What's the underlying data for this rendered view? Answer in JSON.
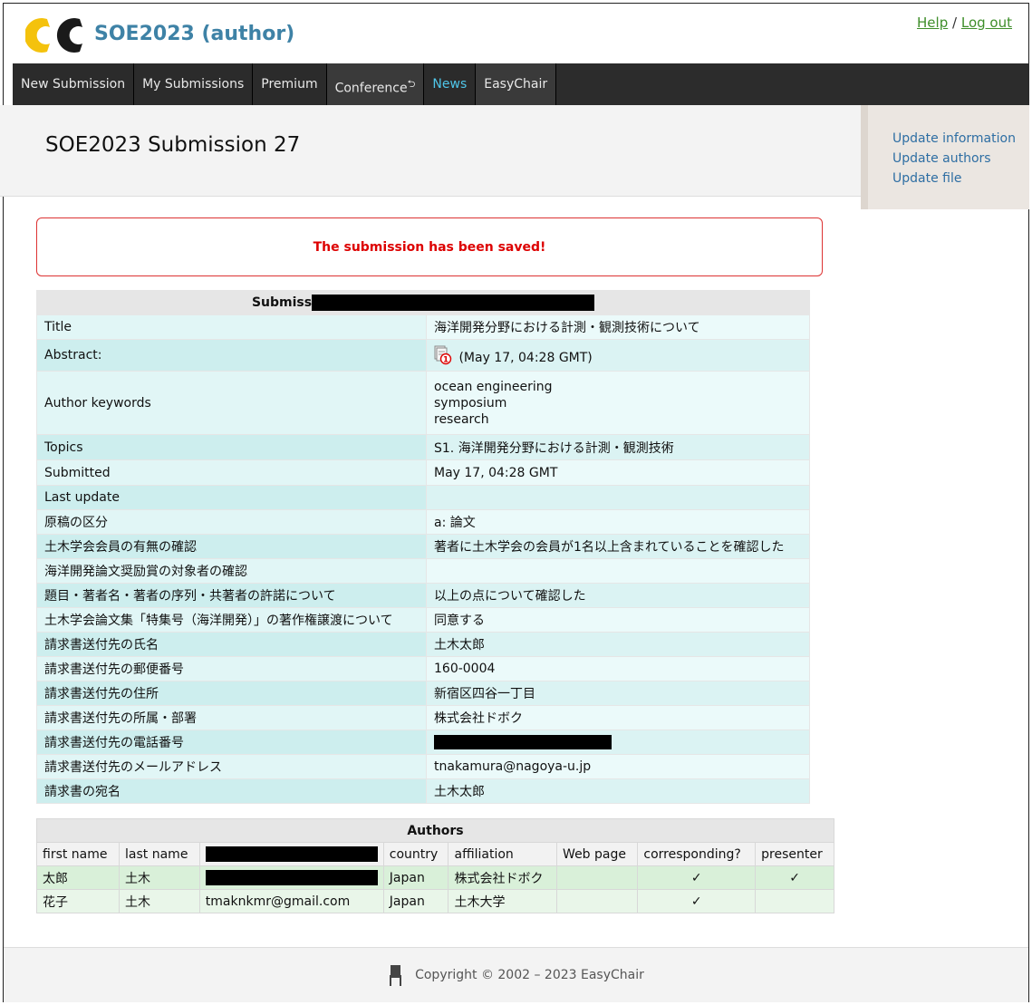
{
  "header": {
    "title": "SOE2023 (author)",
    "help": "Help",
    "separator": "/",
    "logout": "Log out"
  },
  "nav": {
    "items": [
      "New Submission",
      "My Submissions",
      "Premium",
      "Conference",
      "News",
      "EasyChair"
    ]
  },
  "page": {
    "title": "SOE2023 Submission 27"
  },
  "side_menu": {
    "items": [
      "Update information",
      "Update authors",
      "Update file"
    ]
  },
  "message": "The submission has been saved!",
  "submission": {
    "caption": "Submiss",
    "rows": [
      {
        "label": "Title",
        "value": "海洋開発分野における計測・観測技術について"
      },
      {
        "label": "Abstract:",
        "value": "(May 17, 04:28 GMT)"
      },
      {
        "label": "Author keywords",
        "value": [
          "ocean engineering",
          "symposium",
          "research"
        ]
      },
      {
        "label": "Topics",
        "value": "S1. 海洋開発分野における計測・観測技術"
      },
      {
        "label": "Submitted",
        "value": "May 17, 04:28 GMT"
      },
      {
        "label": "Last update",
        "value": ""
      },
      {
        "label": "原稿の区分",
        "value": "a: 論文"
      },
      {
        "label": "土木学会会員の有無の確認",
        "value": "著者に土木学会の会員が1名以上含まれていることを確認した"
      },
      {
        "label": "海洋開発論文奨励賞の対象者の確認",
        "value": ""
      },
      {
        "label": "題目・著者名・著者の序列・共著者の許諾について",
        "value": "以上の点について確認した"
      },
      {
        "label": "土木学会論文集「特集号（海洋開発）」の著作権譲渡について",
        "value": "同意する"
      },
      {
        "label": "請求書送付先の氏名",
        "value": "土木太郎"
      },
      {
        "label": "請求書送付先の郵便番号",
        "value": "160-0004"
      },
      {
        "label": "請求書送付先の住所",
        "value": "新宿区四谷一丁目"
      },
      {
        "label": "請求書送付先の所属・部署",
        "value": "株式会社ドボク"
      },
      {
        "label": "請求書送付先の電話番号",
        "value": ""
      },
      {
        "label": "請求書送付先のメールアドレス",
        "value": "tnakamura@nagoya-u.jp"
      },
      {
        "label": "請求書の宛名",
        "value": "土木太郎"
      }
    ]
  },
  "authors": {
    "caption": "Authors",
    "columns": [
      "first name",
      "last name",
      "",
      "country",
      "affiliation",
      "Web page",
      "corresponding?",
      "presenter"
    ],
    "rows": [
      {
        "first": "太郎",
        "last": "土木",
        "email": "",
        "country": "Japan",
        "affiliation": "株式会社ドボク",
        "web": "",
        "corresponding": "✓",
        "presenter": "✓"
      },
      {
        "first": "花子",
        "last": "土木",
        "email": "tmaknkmr@gmail.com",
        "country": "Japan",
        "affiliation": "土木大学",
        "web": "",
        "corresponding": "✓",
        "presenter": ""
      }
    ]
  },
  "footer": {
    "copyright": "Copyright © 2002 – 2023 EasyChair"
  },
  "colors": {
    "brand_blue": "#3e82a6",
    "logo_yellow": "#f4c20d",
    "link_green": "#3e8e2a",
    "news_cyan": "#4fc6e9",
    "error_red": "#d00000"
  }
}
